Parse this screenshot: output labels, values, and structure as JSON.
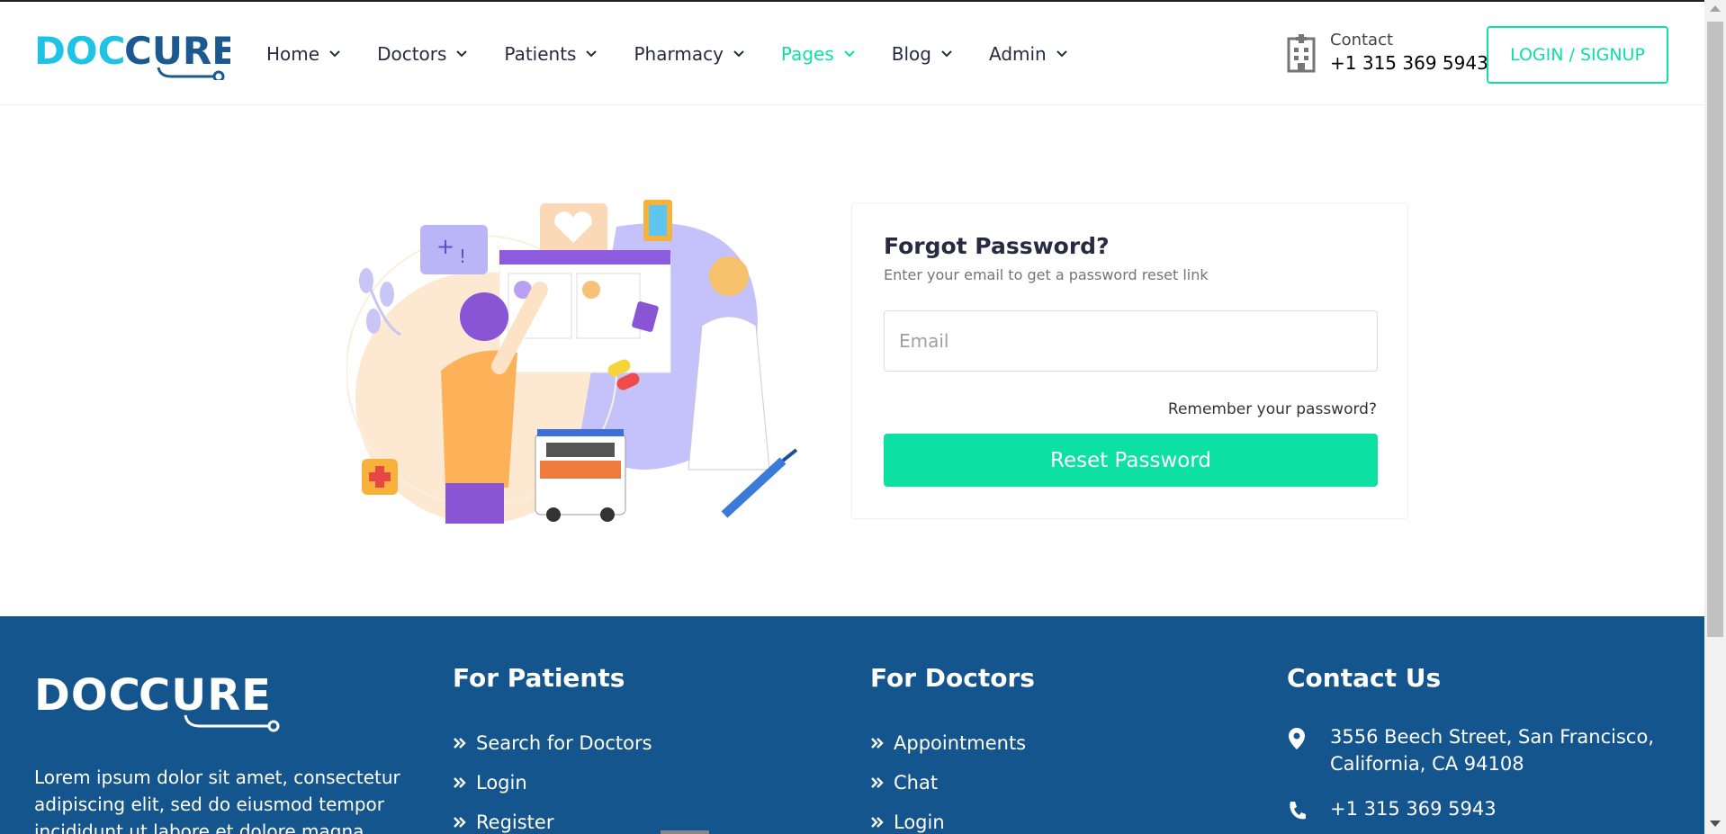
{
  "app": {
    "brand": "DOCCURE",
    "brand_part1": "DOC",
    "brand_part2": "CURE"
  },
  "nav": {
    "items": [
      {
        "label": "Home",
        "active": false
      },
      {
        "label": "Doctors",
        "active": false
      },
      {
        "label": "Patients",
        "active": false
      },
      {
        "label": "Pharmacy",
        "active": false
      },
      {
        "label": "Pages",
        "active": true
      },
      {
        "label": "Blog",
        "active": false
      },
      {
        "label": "Admin",
        "active": false
      }
    ],
    "icon": "chevron-down-icon"
  },
  "header_contact": {
    "label": "Contact",
    "phone": "+1 315 369 5943",
    "icon": "hospital-icon"
  },
  "login_button": {
    "label": "LOGIN / SIGNUP"
  },
  "forgot": {
    "title": "Forgot Password?",
    "subtitle": "Enter your email to get a password reset link",
    "email_placeholder": "Email",
    "email_value": "",
    "remember_link": "Remember your password?",
    "reset_button": "Reset Password"
  },
  "footer": {
    "brand": "DOCCURE",
    "about": "Lorem ipsum dolor sit amet, consectetur adipiscing elit, sed do eiusmod tempor incididunt ut labore et dolore magna",
    "patients": {
      "title": "For Patients",
      "links": [
        "Search for Doctors",
        "Login",
        "Register"
      ]
    },
    "doctors": {
      "title": "For Doctors",
      "links": [
        "Appointments",
        "Chat",
        "Login"
      ]
    },
    "contact": {
      "title": "Contact Us",
      "address_line1": "3556 Beech Street, San Francisco,",
      "address_line2": "California, CA 94108",
      "phone": "+1 315 369 5943"
    }
  },
  "colors": {
    "accent": "#0ce0a3",
    "brand_cyan": "#1ec3e6",
    "brand_blue": "#1b5a90",
    "footer_bg": "#15558d"
  }
}
